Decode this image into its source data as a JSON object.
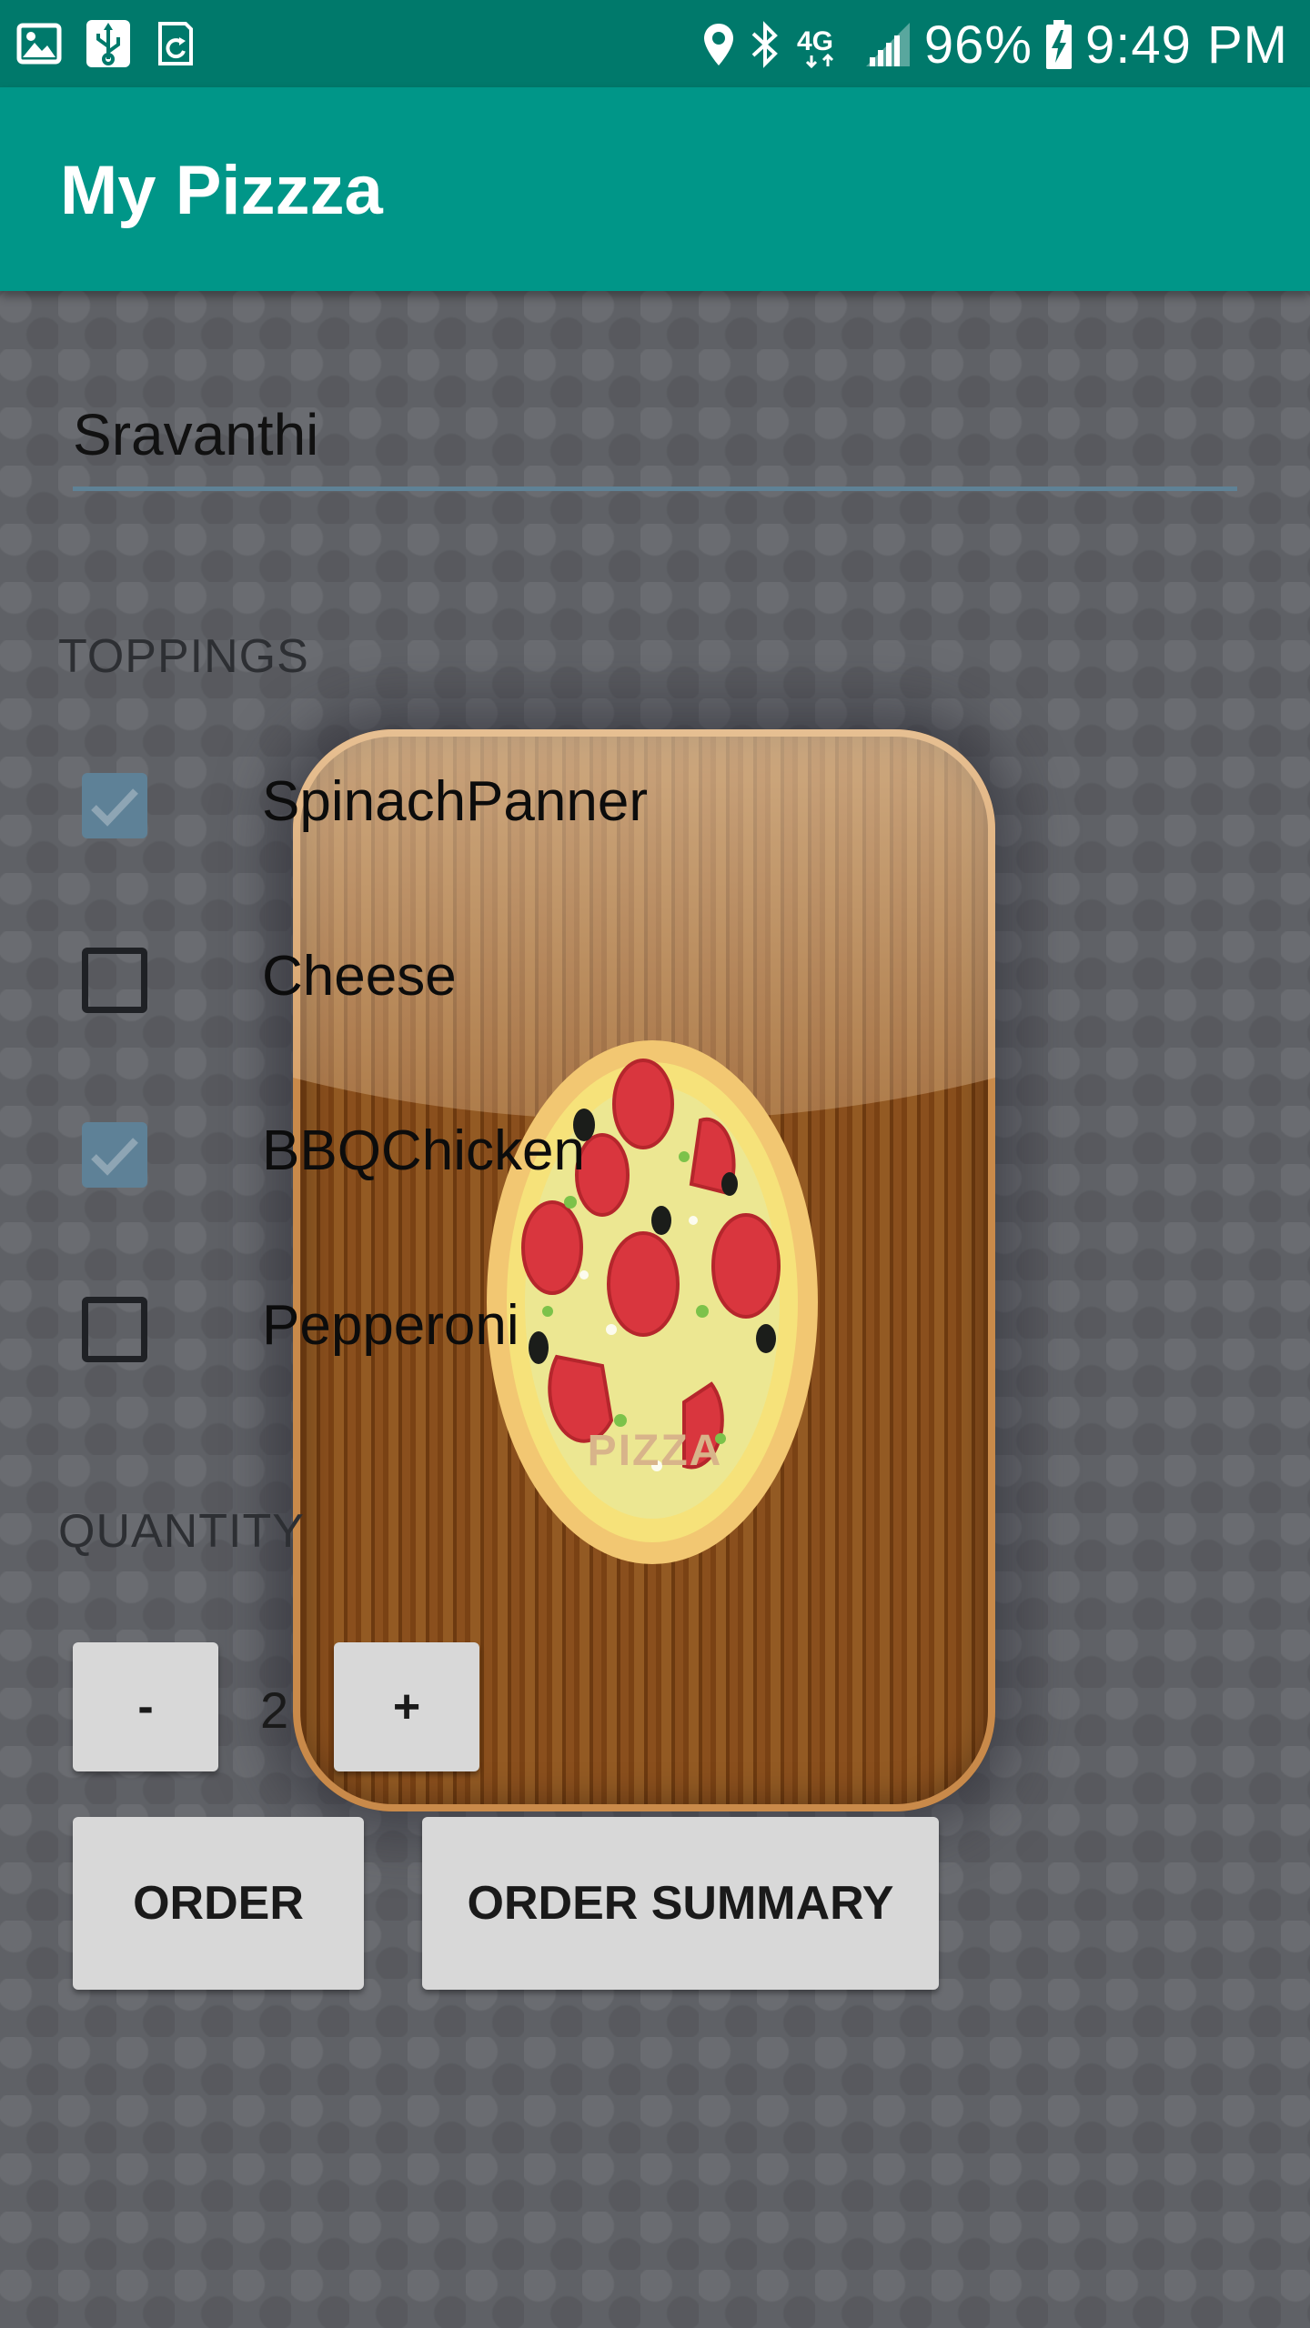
{
  "status_bar": {
    "battery": "96%",
    "time": "9:49 PM",
    "network": "4G",
    "icons": [
      "image-icon",
      "usb-icon",
      "sync-icon",
      "location-icon",
      "bluetooth-icon",
      "network-4g-icon",
      "signal-icon",
      "battery-charging-icon"
    ]
  },
  "app_bar": {
    "title": "My Pizzza"
  },
  "form": {
    "name_value": "Sravanthi",
    "toppings_label": "TOPPINGS",
    "toppings": [
      {
        "label": "SpinachPanner",
        "checked": true
      },
      {
        "label": "Cheese",
        "checked": false
      },
      {
        "label": "BBQChicken",
        "checked": true
      },
      {
        "label": "Pepperoni",
        "checked": false
      }
    ],
    "quantity_label": "QUANTITY",
    "quantity": "2",
    "decrement_label": "-",
    "increment_label": "+",
    "order_label": "ORDER",
    "order_summary_label": "ORDER SUMMARY"
  },
  "background": {
    "box_label": "PIZZA"
  },
  "colors": {
    "status_bar": "#00796b",
    "app_bar": "#009688",
    "checkbox_checked": "#5e8197",
    "button": "#d8d8d8"
  }
}
